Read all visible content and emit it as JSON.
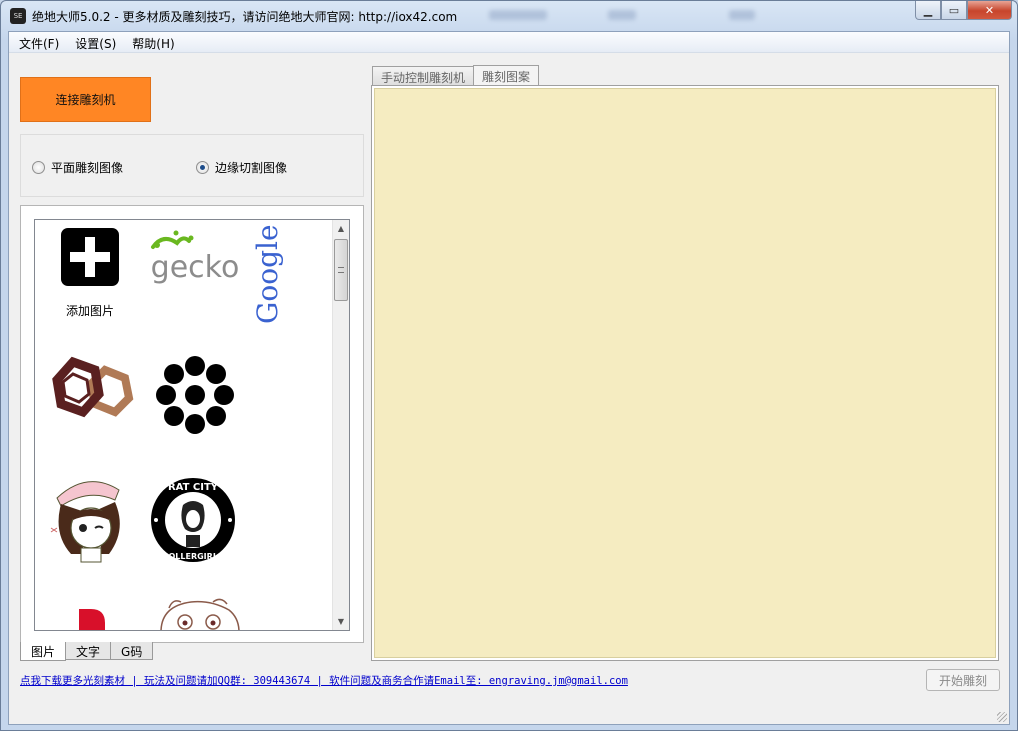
{
  "window": {
    "title": "绝地大师5.0.2 - 更多材质及雕刻技巧，请访问绝地大师官网: http://iox42.com",
    "icon_text": "SE"
  },
  "menu": [
    "文件(F)",
    "设置(S)",
    "帮助(H)"
  ],
  "connect_button": "连接雕刻机",
  "mode": {
    "options": [
      "平面雕刻图像",
      "边缘切割图像"
    ],
    "selected": "边缘切割图像"
  },
  "gallery": {
    "add_label": "添加图片",
    "items": [
      "add-image",
      "gecko-logo",
      "google-logo",
      "hexagon-logo",
      "flower-logo",
      "girl-cartoon",
      "rat-city-rollergirls-logo",
      "red-logo",
      "cartoon-monster"
    ],
    "gecko_text": "gecko",
    "google_text": "Google",
    "rat_city_top": "RAT CITY",
    "rat_city_bottom": "ROLLERGIRLS"
  },
  "left_tabs": [
    "图片",
    "文字",
    "G码"
  ],
  "left_tab_active": "图片",
  "right_tabs": [
    "手动控制雕刻机",
    "雕刻图案"
  ],
  "right_tab_active": "雕刻图案",
  "footer": {
    "link": "点我下载更多光刻素材 | 玩法及问题请加QQ群: 309443674 | 软件问题及商务合作请Email至: engraving.jm@gmail.com",
    "start_button": "开始雕刻"
  },
  "colors": {
    "connect_button": "#ff8624",
    "canvas": "#f5ecc1",
    "link": "#0000cc"
  }
}
